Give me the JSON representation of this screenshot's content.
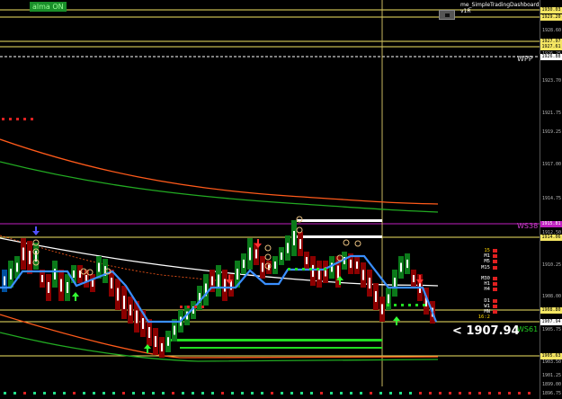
{
  "header": {
    "alma_badge": "alma ON",
    "dashboard_title": "me_SimpleTradingDashboard v1R"
  },
  "price_scale": {
    "ticks": [
      "1928.60",
      "1926.25",
      "1923.70",
      "1921.75",
      "1919.25",
      "1917.00",
      "1914.75",
      "1912.50",
      "1910.25",
      "1908.00",
      "1905.75",
      "1903.50",
      "1901.25",
      "1899.00",
      "1896.75"
    ],
    "tags": [
      {
        "text": "1930.03",
        "color": "#f5e663",
        "fg": "#000"
      },
      {
        "text": "1929.20",
        "color": "#f5e663",
        "fg": "#000"
      },
      {
        "text": "1927.97",
        "color": "#f5e663",
        "fg": "#000"
      },
      {
        "text": "1927.61",
        "color": "#f5e663",
        "fg": "#000"
      },
      {
        "text": "1926.88",
        "color": "#ffffff",
        "fg": "#000"
      },
      {
        "text": "1915.81",
        "color": "#c020c0",
        "fg": "#fff"
      },
      {
        "text": "1914.06",
        "color": "#f5e663",
        "fg": "#000"
      },
      {
        "text": "1908.80",
        "color": "#f5e663",
        "fg": "#000"
      },
      {
        "text": "1907.94",
        "color": "#ffffff",
        "fg": "#000"
      },
      {
        "text": "1905.63",
        "color": "#f5e663",
        "fg": "#000"
      }
    ]
  },
  "levels": {
    "wpp_label": "WPP",
    "ws38_label": "WS38",
    "ws61_label": "WS61"
  },
  "current_price": "<  1907.94",
  "timeframes": {
    "top_count": "15",
    "rows": [
      {
        "label": "M1",
        "color": "#e02020"
      },
      {
        "label": "M5",
        "color": "#e02020"
      },
      {
        "label": "M15",
        "color": "#e02020"
      },
      {
        "label": "",
        "color": ""
      },
      {
        "label": "M30",
        "color": "#e02020"
      },
      {
        "label": "H1",
        "color": "#e02020"
      },
      {
        "label": "H4",
        "color": "#e02020"
      },
      {
        "label": "",
        "color": ""
      },
      {
        "label": "D1",
        "color": "#e02020"
      },
      {
        "label": "W1",
        "color": "#e02020"
      },
      {
        "label": "MN",
        "color": "#e02020"
      }
    ],
    "countdown": "16:2"
  },
  "colors": {
    "bull_candle": "#0b7a1a",
    "bear_candle": "#8b0000",
    "trend_line": "#3a8fff",
    "grid_line": "#f5e663",
    "green_signal": "#22dd22",
    "red_signal": "#dd2222",
    "ma_red": "#ff5a1a",
    "ma_green": "#22aa22"
  },
  "icons": {
    "buy_arrow": "green-up-arrow-icon",
    "sell_arrow": "red-down-arrow-icon",
    "swing_marker": "circle-marker-icon"
  }
}
